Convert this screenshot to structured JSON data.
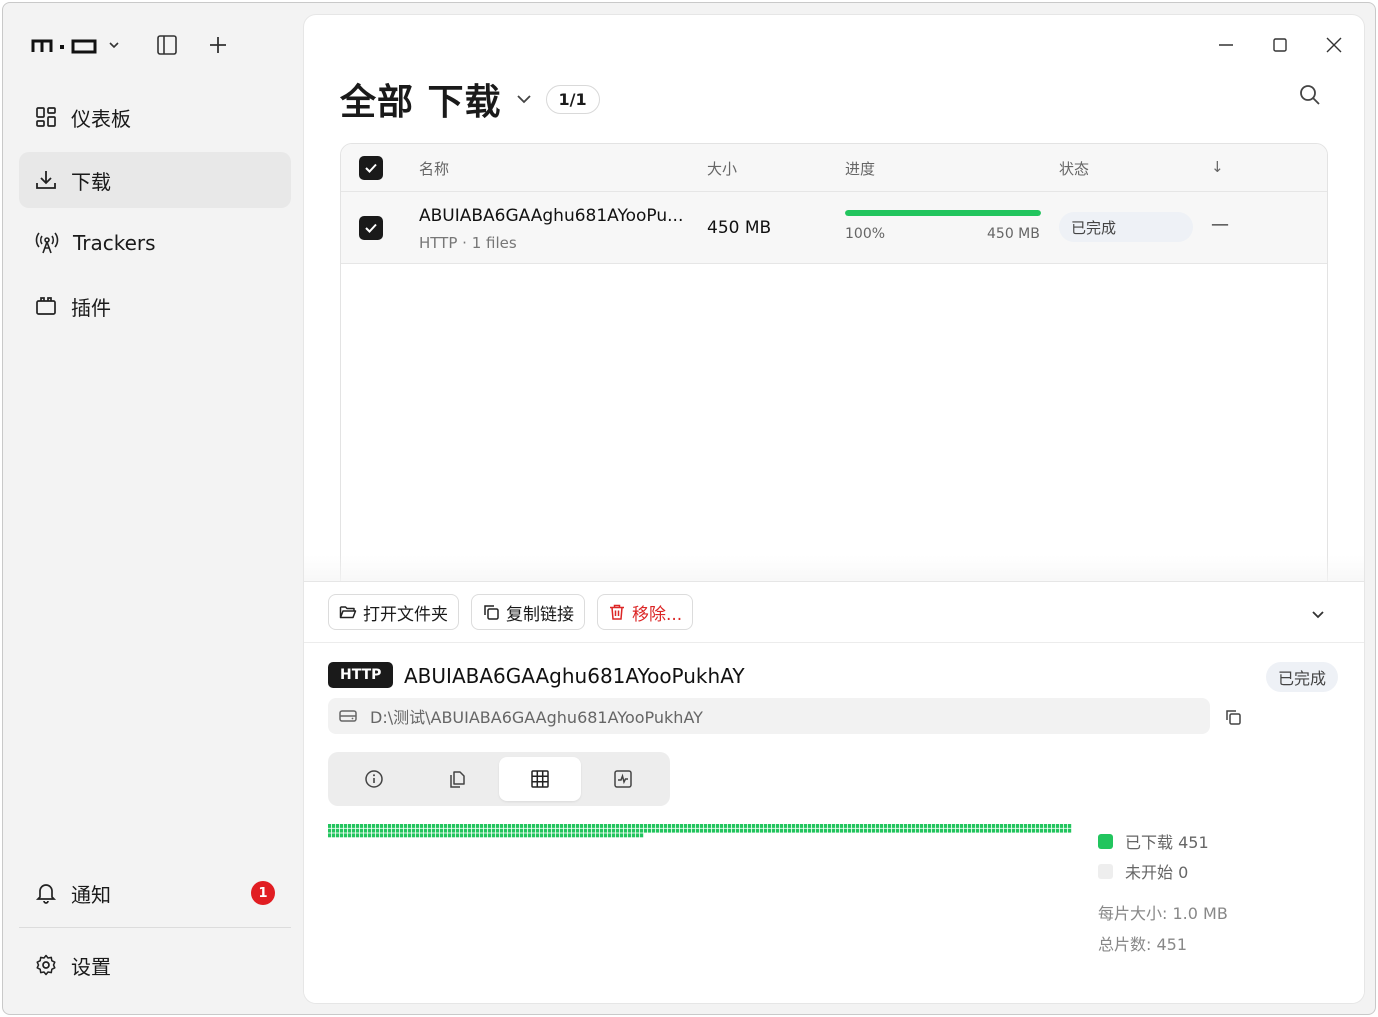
{
  "sidebar": {
    "items": [
      {
        "label": "仪表板",
        "icon": "dashboard-icon"
      },
      {
        "label": "下载",
        "icon": "download-icon"
      },
      {
        "label": "Trackers",
        "icon": "antenna-icon"
      },
      {
        "label": "插件",
        "icon": "plugin-icon"
      }
    ],
    "notifications": {
      "label": "通知",
      "count": "1"
    },
    "settings": {
      "label": "设置"
    }
  },
  "header": {
    "title": "全部 下载",
    "count": "1/1"
  },
  "table": {
    "columns": [
      "名称",
      "大小",
      "进度",
      "状态",
      "↓"
    ],
    "rows": [
      {
        "name": "ABUIABA6GAAghu681AYooPu...",
        "sub": "HTTP · 1 files",
        "size": "450 MB",
        "progress": 1.0,
        "progress_pct": "100%",
        "progress_size": "450 MB",
        "status": "已完成",
        "speed": "—"
      }
    ]
  },
  "detail": {
    "actions": {
      "open_folder": "打开文件夹",
      "copy_link": "复制链接",
      "remove": "移除..."
    },
    "protocol": "HTTP",
    "name": "ABUIABA6GAAghu681AYooPukhAY",
    "status": "已完成",
    "path": "D:\\测试\\ABUIABA6GAAghu681AYooPukhAY",
    "tabs": [
      "info-icon",
      "files-icon",
      "grid-icon",
      "activity-icon"
    ],
    "active_tab": 2,
    "pieces": {
      "downloaded_label": "已下载 451",
      "pending_label": "未开始 0",
      "piece_size": "每片大小: 1.0 MB",
      "total": "总片数: 451",
      "count": 451,
      "done": 451,
      "color_done": "#22c55e",
      "color_pending": "#eeeeee"
    }
  },
  "colors": {
    "accent": "#22c55e",
    "danger": "#dc2626",
    "badge": "#e11d22"
  }
}
